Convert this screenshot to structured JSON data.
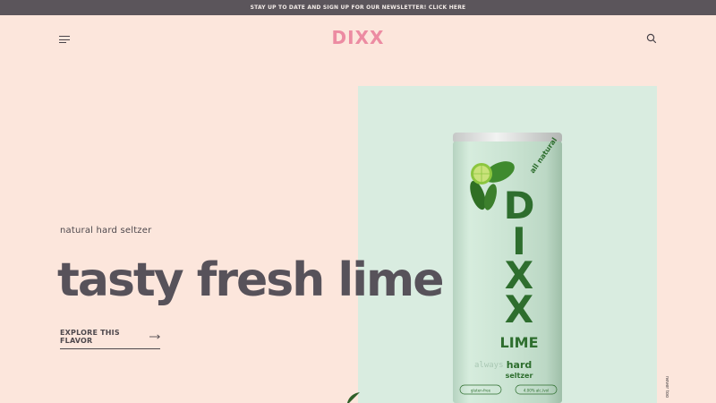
{
  "announcement": {
    "text": "STAY UP TO DATE AND SIGN UP FOR OUR NEWSLETTER! CLICK HERE"
  },
  "header": {
    "logo": "DIXX",
    "menu_icon": "hamburger-menu-icon",
    "search_icon": "search-icon"
  },
  "hero": {
    "kicker": "natural hard seltzer",
    "headline": "tasty fresh lime",
    "cta_label": "EXPLORE THIS FLAVOR",
    "cta_icon": "arrow-right-icon",
    "side_text": "never too"
  },
  "product_can": {
    "brand": "DIXX",
    "flavor": "LIME",
    "tag": "all natural",
    "line1": "hard",
    "line2": "seltzer",
    "band_text": "always",
    "badge_left": "gluten-free",
    "badge_right": "4.00% alc./vol"
  },
  "colors": {
    "page_bg": "#fce6dc",
    "topbar_bg": "#5b555b",
    "logo": "#ec8ba2",
    "panel_bg": "#d9ece0",
    "can_body": "#c9e3d2",
    "can_text": "#2e6e2e"
  }
}
